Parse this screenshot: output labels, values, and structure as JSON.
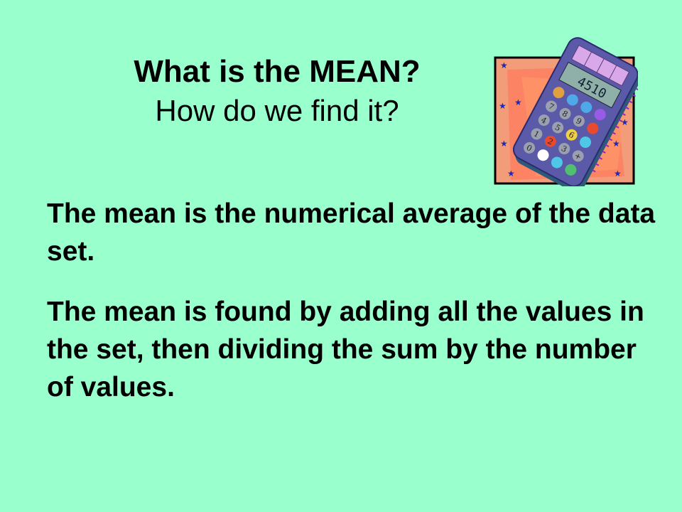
{
  "slide": {
    "title": "What is the MEAN?",
    "subtitle": "How do we find it?",
    "paragraphs": [
      "The mean is the numerical average of the data set.",
      "The mean is found by adding all the values in the set, then dividing the sum by the number of values."
    ],
    "calculator_display": "4510",
    "calculator_keys": [
      "7",
      "8",
      "9",
      "4",
      "5",
      "6",
      "1",
      "2",
      "3",
      "0"
    ]
  },
  "colors": {
    "background": "#99FFCC",
    "clipart_border": "#000000",
    "calculator_body": "#5A5AA8"
  }
}
